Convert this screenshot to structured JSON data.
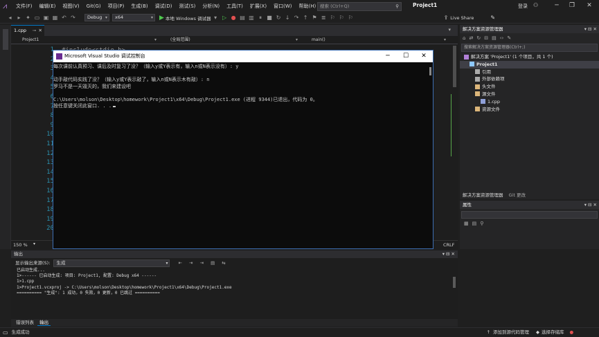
{
  "menu": {
    "items": [
      "文件(F)",
      "编辑(E)",
      "视图(V)",
      "Git(G)",
      "项目(P)",
      "生成(B)",
      "调试(D)",
      "测试(S)",
      "分析(N)",
      "工具(T)",
      "扩展(X)",
      "窗口(W)",
      "帮助(H)"
    ],
    "search_placeholder": "搜索 (Ctrl+Q)",
    "project_name": "Project1",
    "sign_in": "登录"
  },
  "toolbar": {
    "config": "Debug",
    "platform": "x64",
    "run_label": "本地 Windows 调试器",
    "live_share": "Live Share"
  },
  "editor": {
    "tab_label": "1.cpp",
    "nav_project": "Project1",
    "nav_scope": "(全局范围)",
    "nav_func": "main()",
    "line_numbers": [
      "1",
      "2",
      "3",
      "4",
      "5",
      "6",
      "7",
      "8",
      "9",
      "10",
      "11",
      "12",
      "13",
      "14",
      "15",
      "16",
      "17",
      "18",
      "19",
      "20"
    ],
    "code_line1": "#include<stdio.h>",
    "zoom": "150 %",
    "line_ending": "CRLF"
  },
  "console": {
    "title": "Microsoft Visual Studio 调试控制台",
    "lines": [
      "每次课前认真预习、课后及时复习了没？（输入y或Y表示有，输入n或N表示没有）: y",
      "",
      "动手敲代码实践了没？（输入y或Y表示敲了，输入n或N表示木有敲）: n",
      "罗马不是一天毁灭的，我们来建设吧",
      "",
      "C:\\Users\\molson\\Desktop\\homework\\Project1\\x64\\Debug\\Project1.exe (进程 9344)已退出，代码为 0。",
      "按任意键关闭此窗口. . ."
    ]
  },
  "solution_explorer": {
    "title": "解决方案资源管理器",
    "search_placeholder": "搜索解决方案资源管理器(Ctrl+;)",
    "tree": [
      {
        "label": "解决方案 'Project1' (1 个项目，共 1 个)",
        "indent": 0,
        "icon": "solution-icon"
      },
      {
        "label": "Project1",
        "indent": 1,
        "icon": "project-icon",
        "bold": true
      },
      {
        "label": "引用",
        "indent": 2,
        "icon": "references-icon"
      },
      {
        "label": "外部依赖项",
        "indent": 2,
        "icon": "external-deps-icon"
      },
      {
        "label": "头文件",
        "indent": 2,
        "icon": "folder-icon"
      },
      {
        "label": "源文件",
        "indent": 2,
        "icon": "folder-icon"
      },
      {
        "label": "1.cpp",
        "indent": 3,
        "icon": "cpp-file-icon"
      },
      {
        "label": "资源文件",
        "indent": 2,
        "icon": "folder-icon"
      }
    ],
    "tab_solution": "解决方案资源管理器",
    "tab_git": "Git 更改"
  },
  "properties": {
    "title": "属性"
  },
  "output": {
    "title": "输出",
    "show_from_label": "显示输出来源(S):",
    "source": "生成",
    "lines": [
      "已启动生成...",
      "1>------ 已启动生成: 项目: Project1, 配置: Debug x64 ------",
      "1>1.cpp",
      "1>Project1.vcxproj -> C:\\Users\\molson\\Desktop\\homework\\Project1\\x64\\Debug\\Project1.exe",
      "========== \"生成\": 1 成功，0 失败，0 更新，0 已跳过 =========="
    ],
    "tab_errors": "错误列表",
    "tab_output": "输出"
  },
  "status": {
    "left": "生成成功",
    "add_source": "添加到源代码管理",
    "select_repo": "选择存储库"
  },
  "colors": {
    "accent": "#007acc",
    "console_border": "#3d6fb3",
    "line_number": "#2b91af",
    "change_bar": "#57a64a"
  }
}
